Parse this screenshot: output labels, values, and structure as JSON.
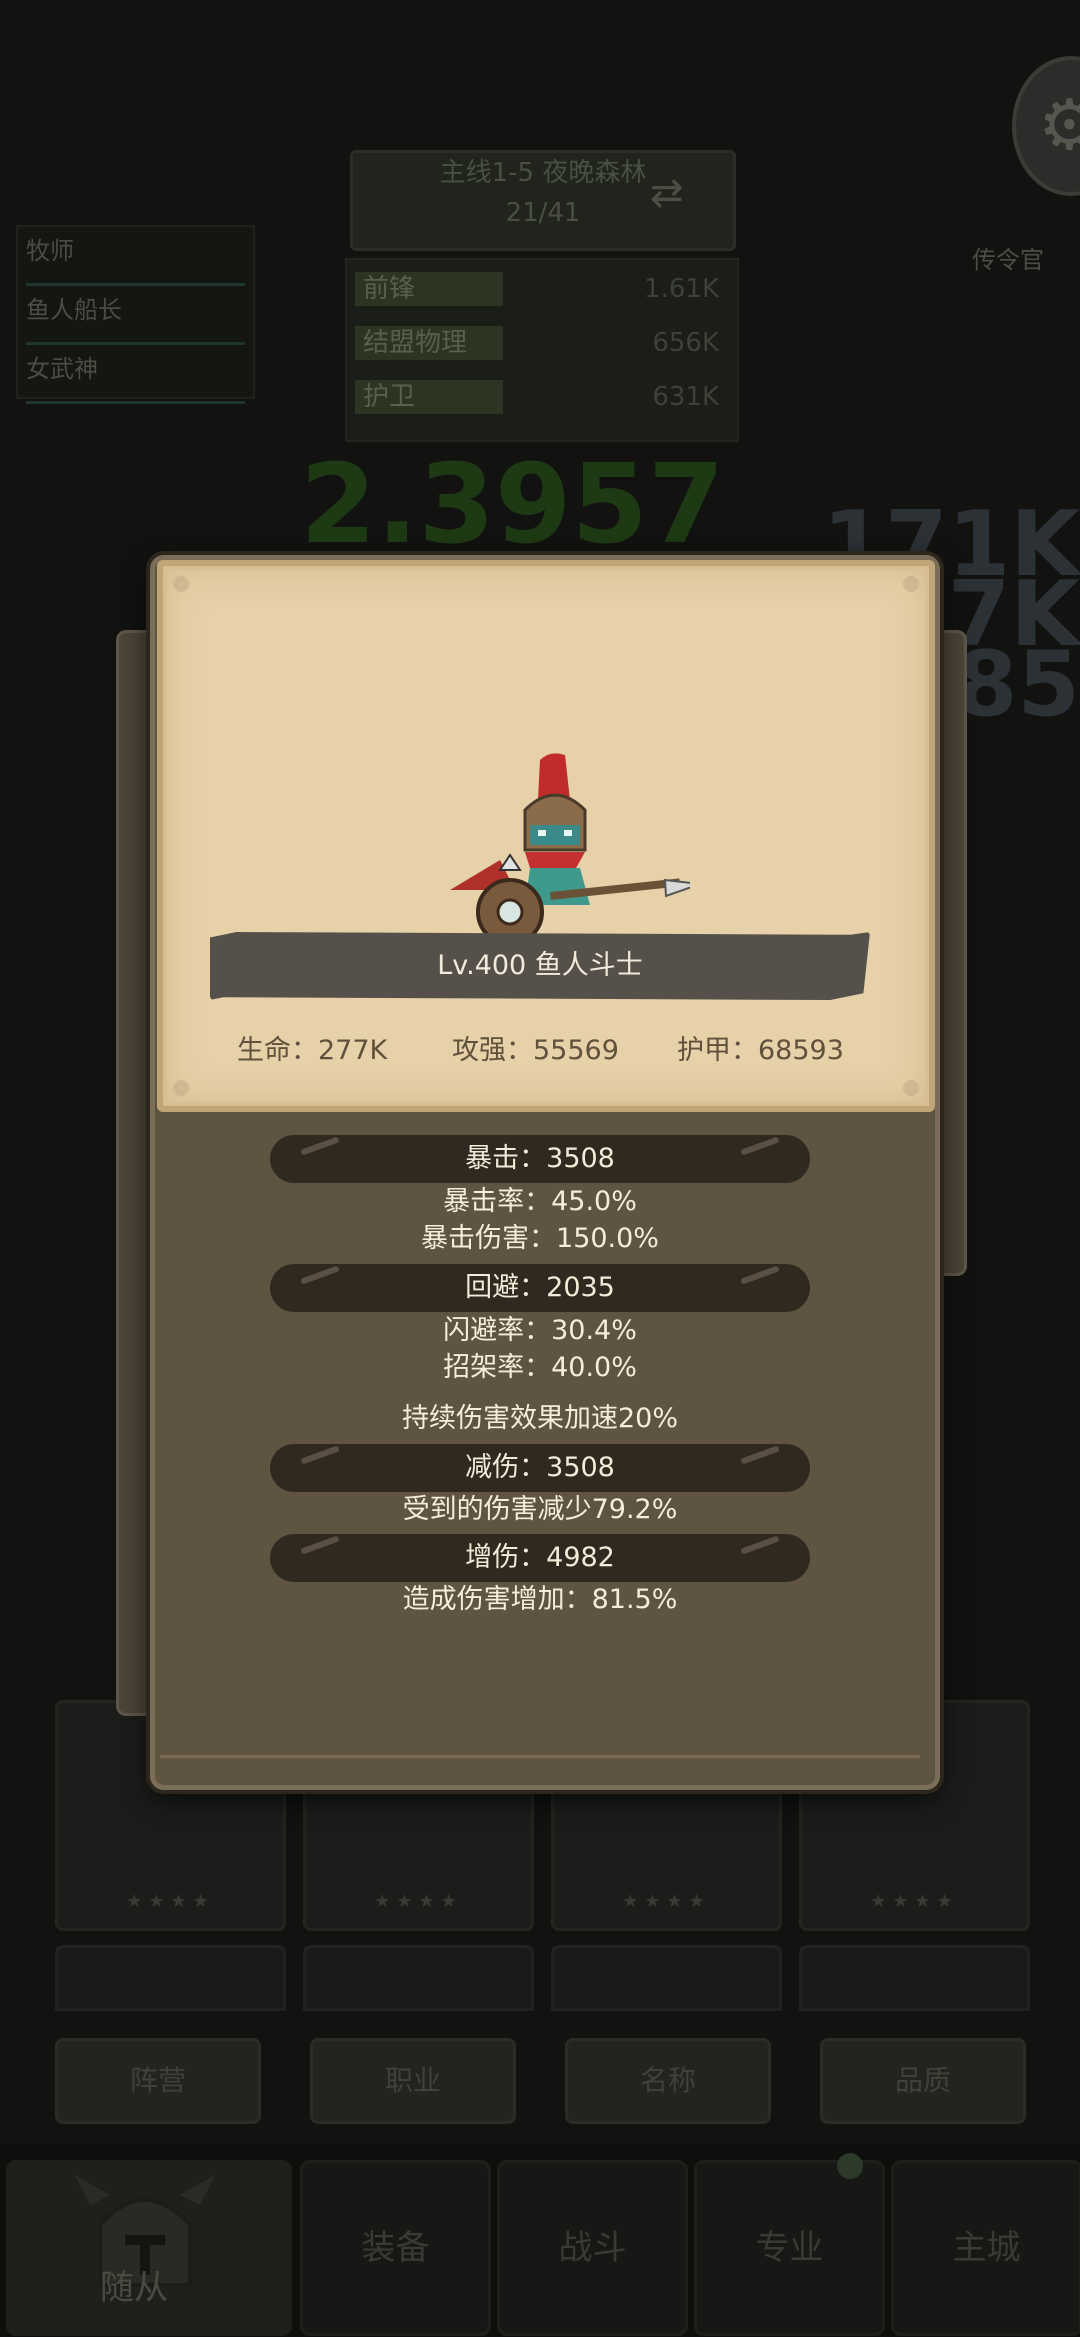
{
  "background": {
    "title_line1": "主线1-5 夜晚森林",
    "title_line2": "21/41",
    "stats": [
      {
        "name": "前锋",
        "value": "1.61K"
      },
      {
        "name": "结盟物理",
        "value": "656K"
      },
      {
        "name": "护卫",
        "value": "631K"
      }
    ],
    "left_list": [
      "牧师",
      "鱼人船长",
      "女武神"
    ],
    "right_title": "传令官",
    "big_number": "2.3957",
    "right_numbers": [
      "171K",
      "27K",
      "785"
    ],
    "buttons": [
      "阵营",
      "职业",
      "名称",
      "品质"
    ],
    "nav": {
      "tabs": [
        "装备",
        "战斗",
        "专业",
        "主城"
      ],
      "active_label": "随从"
    }
  },
  "unit": {
    "name_label": "Lv.400 鱼人斗士",
    "hp_label": "生命：277K",
    "atk_label": "攻强：55569",
    "armor_label": "护甲：68593"
  },
  "details": {
    "crit_title": "暴击：3508",
    "crit_rate": "暴击率：45.0%",
    "crit_damage": "暴击伤害：150.0%",
    "dodge_title": "回避：2035",
    "dodge_rate": "闪避率：30.4%",
    "parry_rate": "招架率：40.0%",
    "dot_bonus": "持续伤害效果加速20%",
    "reduce_title": "减伤：3508",
    "reduce_effect": "受到的伤害减少79.2%",
    "increase_title": "增伤：4982",
    "increase_effect": "造成伤害增加：81.5%"
  },
  "colors": {
    "parchment": "#e6d1a8",
    "panel": "#5f5442",
    "pill": "#2f2920",
    "banner": "#55514a"
  },
  "icons": {
    "settings": "gear-icon",
    "hero": "murloc-gladiator-portrait",
    "nav_active": "helmet-icon"
  }
}
